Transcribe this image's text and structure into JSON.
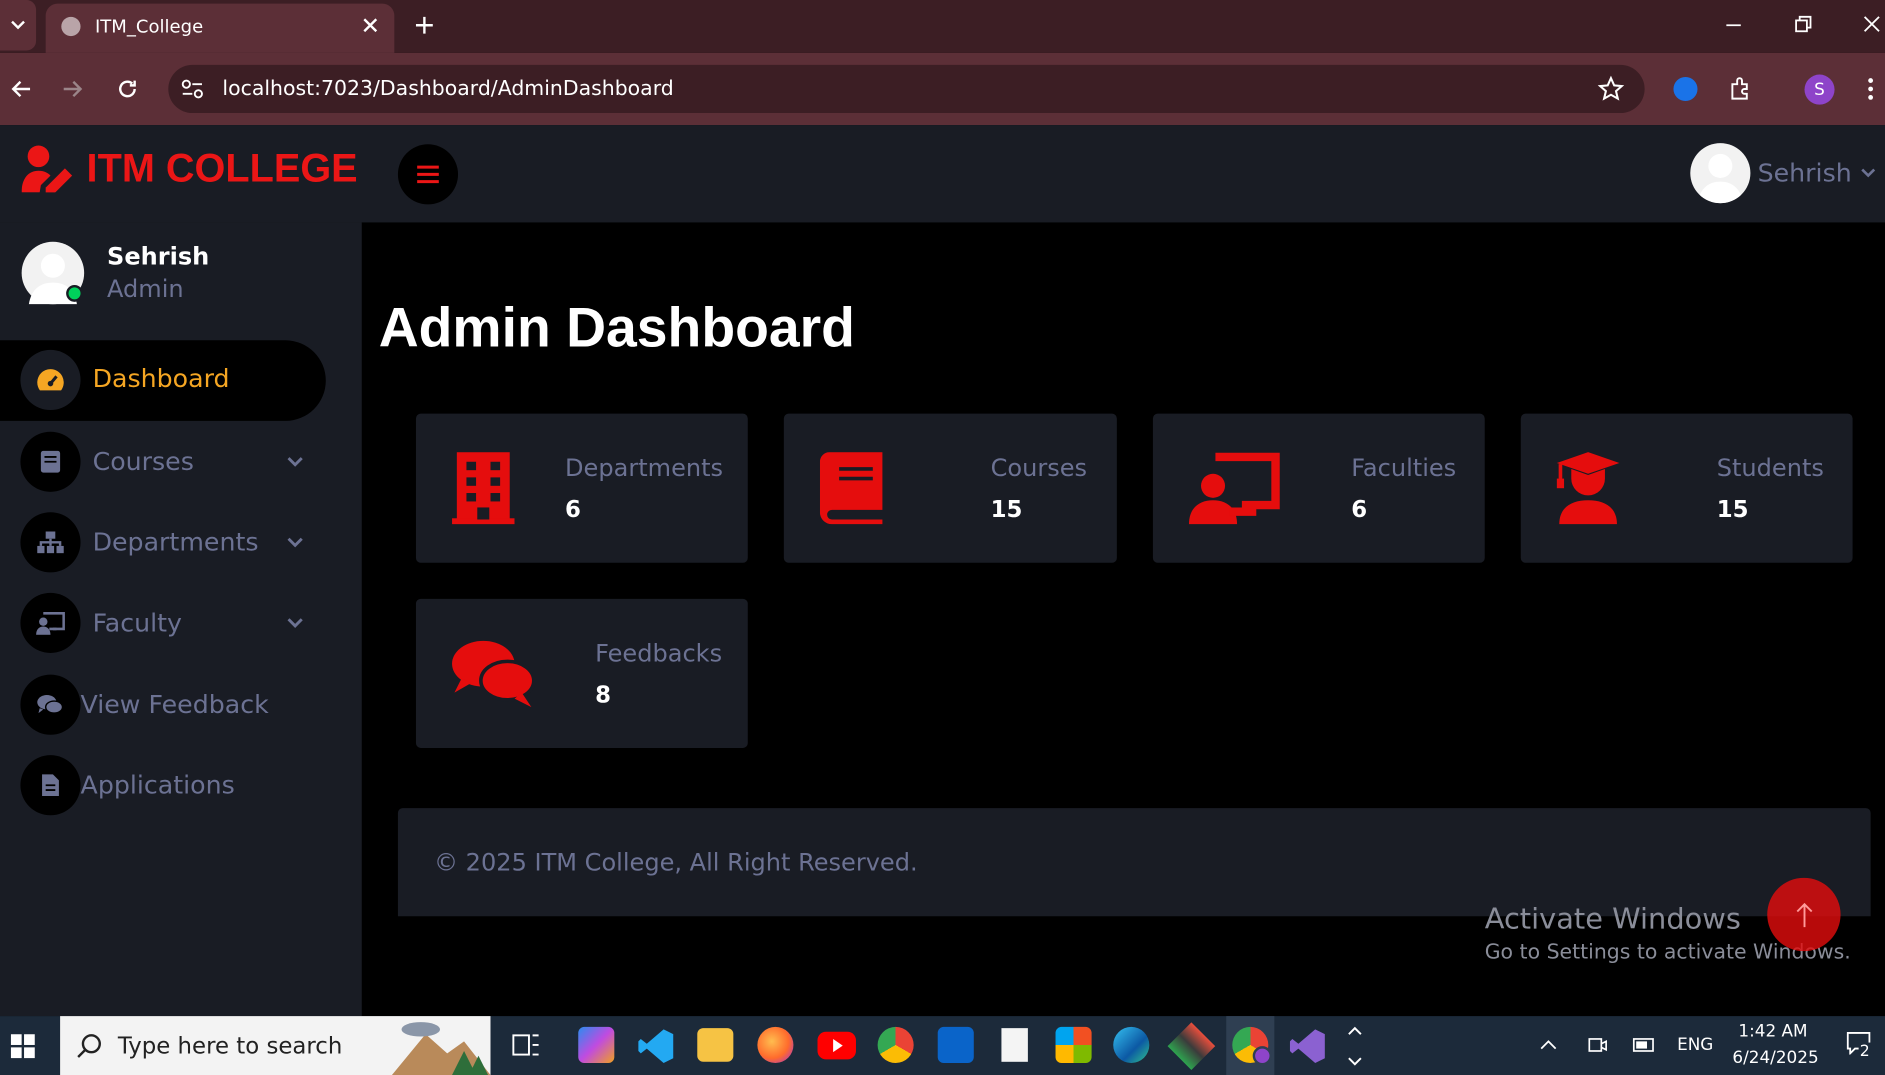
{
  "browser": {
    "tab_title": "ITM_College",
    "url": "localhost:7023/Dashboard/AdminDashboard",
    "profile_initial": "S"
  },
  "app": {
    "brand": "ITM COLLEGE",
    "header_user": "Sehrish"
  },
  "sidebar": {
    "profile_name": "Sehrish",
    "profile_role": "Admin",
    "items": [
      {
        "label": "Dashboard"
      },
      {
        "label": "Courses"
      },
      {
        "label": "Departments"
      },
      {
        "label": "Faculty"
      },
      {
        "label": "View Feedback"
      },
      {
        "label": "Applications"
      }
    ]
  },
  "main": {
    "title": "Admin Dashboard",
    "cards": [
      {
        "label": "Departments",
        "value": "6",
        "icon": "building-icon"
      },
      {
        "label": "Courses",
        "value": "15",
        "icon": "book-icon"
      },
      {
        "label": "Faculties",
        "value": "6",
        "icon": "chalkboard-teacher-icon"
      },
      {
        "label": "Students",
        "value": "15",
        "icon": "graduate-icon"
      },
      {
        "label": "Feedbacks",
        "value": "8",
        "icon": "comments-icon"
      }
    ],
    "footer": "© 2025 ITM College, All Right Reserved."
  },
  "watermark": {
    "title": "Activate Windows",
    "subtitle": "Go to Settings to activate Windows."
  },
  "taskbar": {
    "search_placeholder": "Type here to search",
    "language": "ENG",
    "time": "1:42 AM",
    "date": "6/24/2025",
    "notification_count": "2"
  },
  "colors": {
    "accent_red": "#e50d0d",
    "brand_red": "#eb1616",
    "active_orange": "#f5a623",
    "sidebar_bg": "#191c24",
    "muted_text": "#6c7293"
  }
}
